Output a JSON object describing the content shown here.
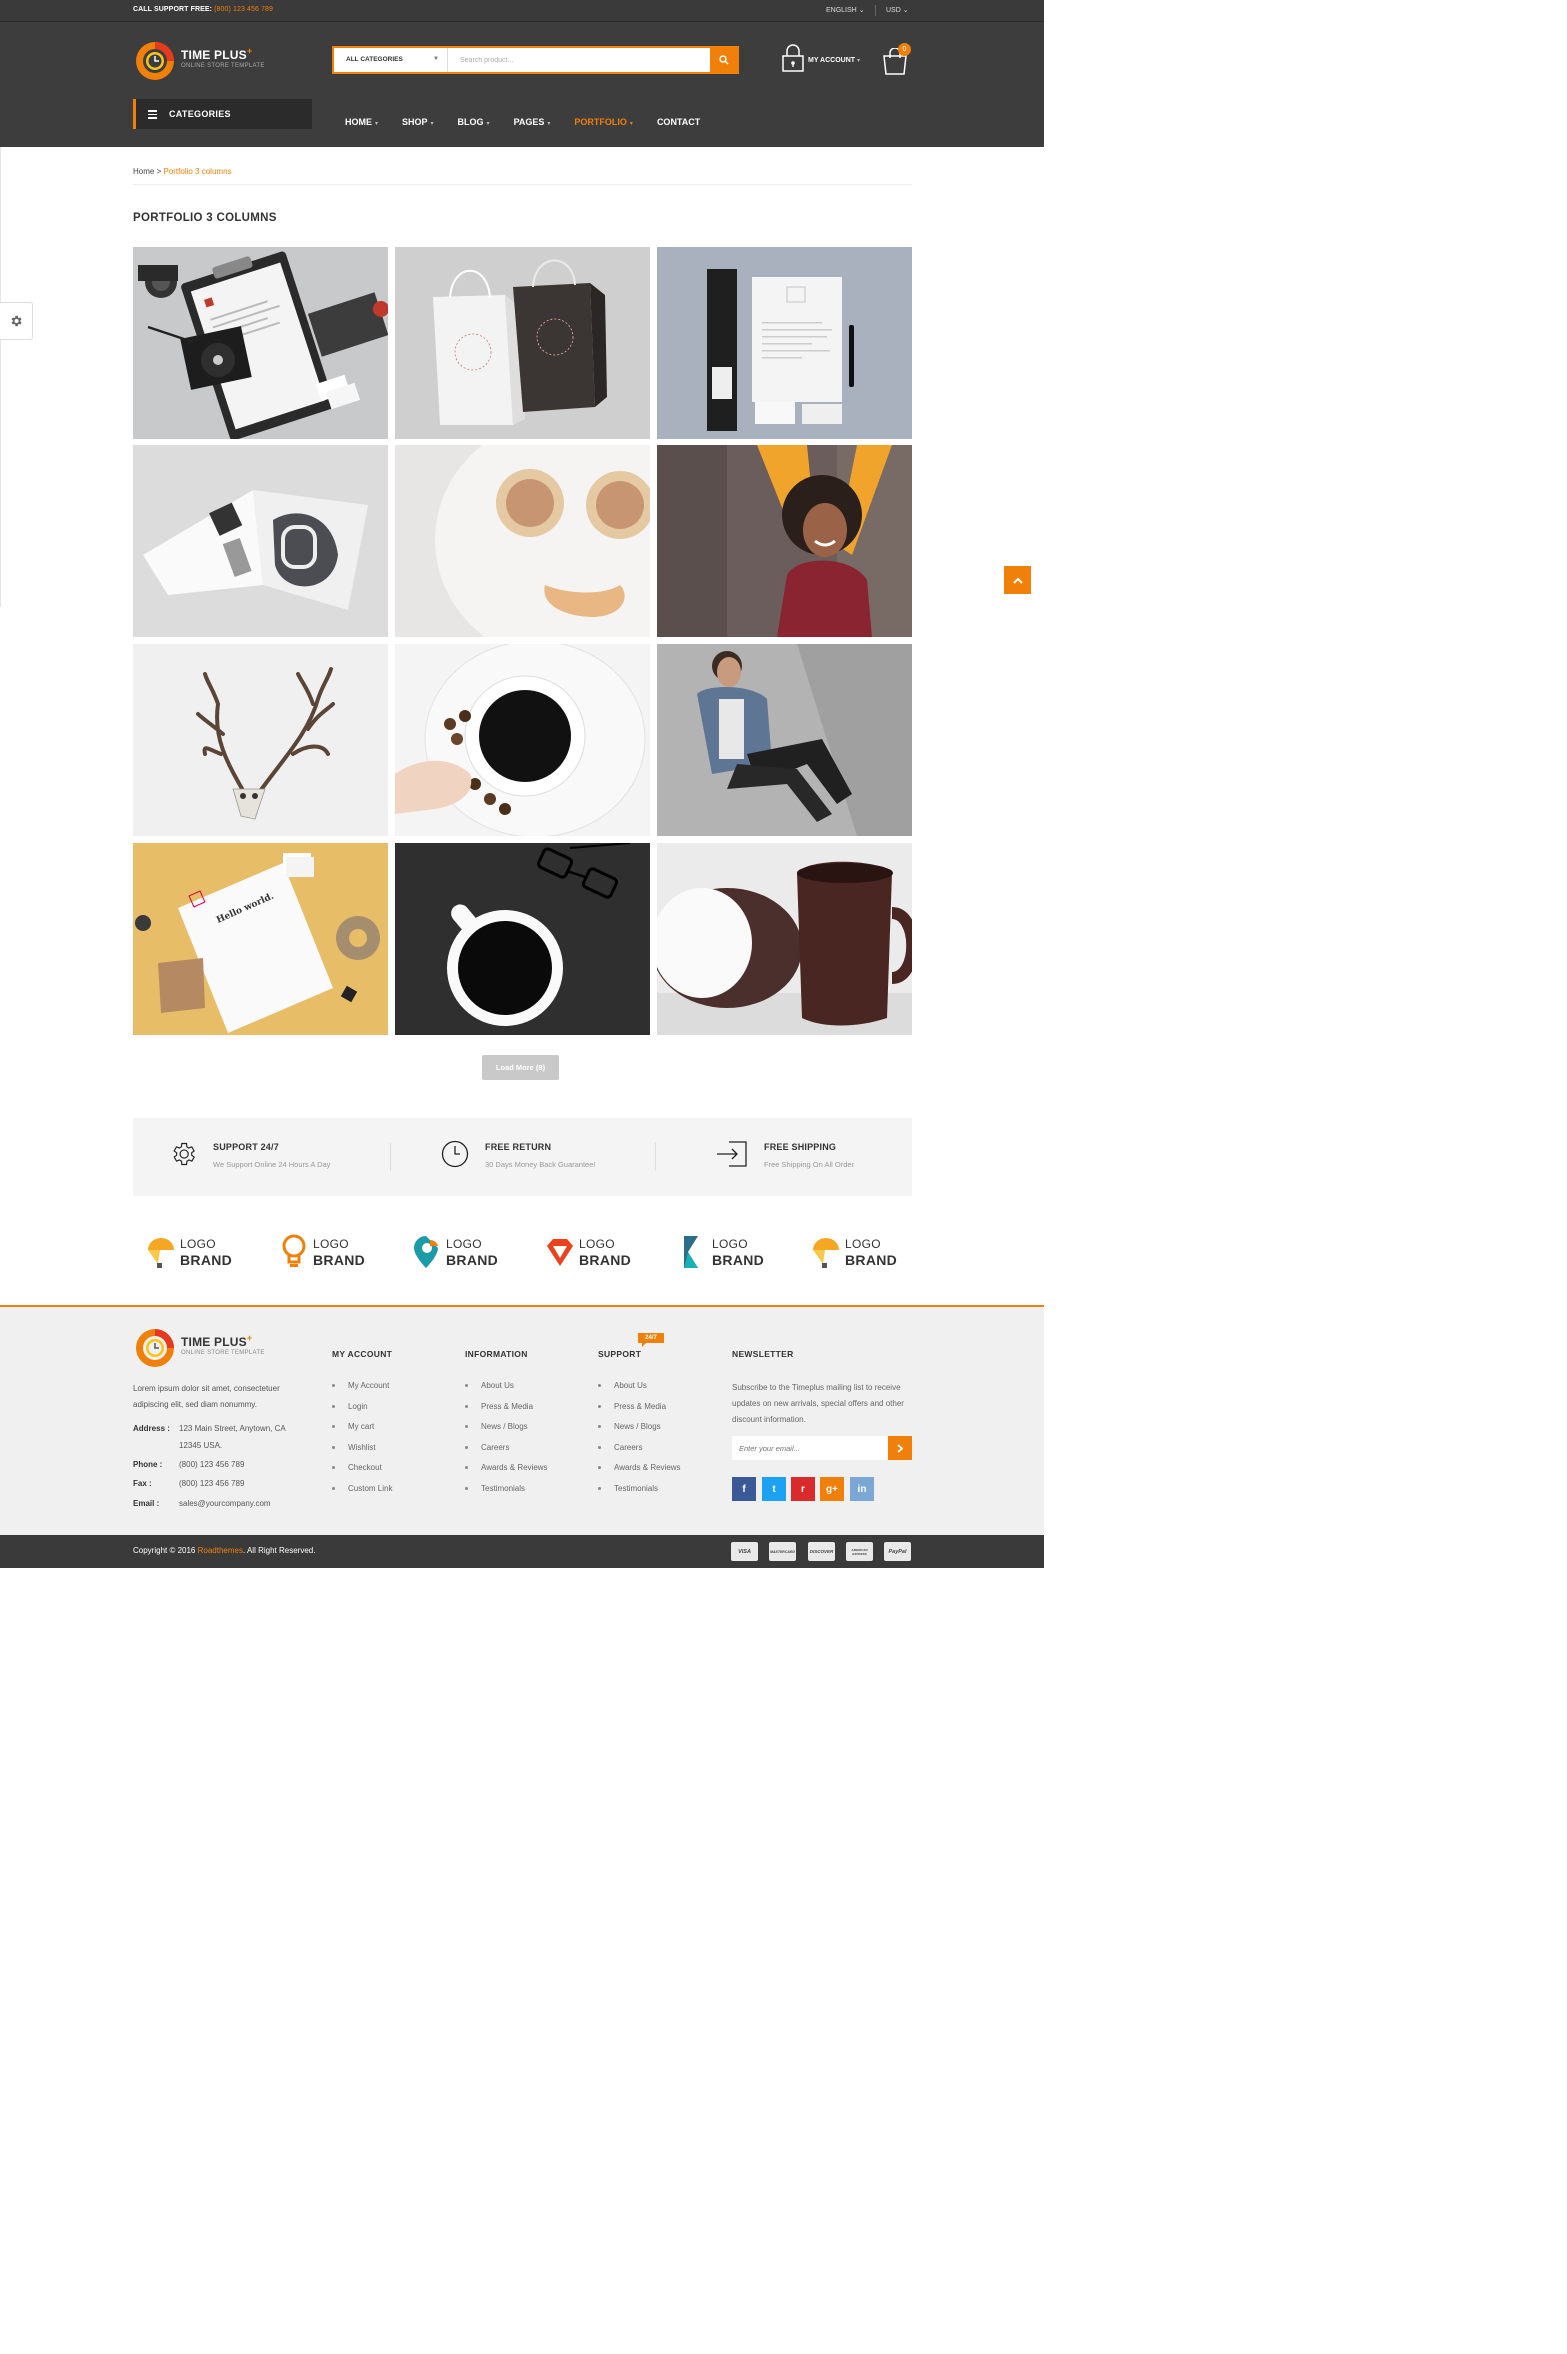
{
  "topbar": {
    "support_label": "CALL SUPPORT FREE:",
    "support_phone": "(800) 123 456  789",
    "language": "ENGLISH",
    "currency": "USD"
  },
  "header": {
    "logo_title": "TIME PLUS",
    "logo_subtitle": "ONLINE STORE TEMPLATE",
    "search_category": "ALL CATEGORIES",
    "search_placeholder": "Search product...",
    "account_label": "MY ACCOUNT",
    "cart_count": "0",
    "categories_label": "CATEGORIES",
    "nav": [
      "HOME",
      "SHOP",
      "BLOG",
      "PAGES",
      "PORTFOLIO",
      "CONTACT"
    ],
    "active_nav": "PORTFOLIO"
  },
  "breadcrumb": {
    "home": "Home",
    "separator": ">",
    "current": "Portfolio 3 columns"
  },
  "page_title": "PORTFOLIO 3 COLUMNS",
  "portfolio_items": [
    "stationery-clipboard-mockup",
    "shopping-bag-mockup",
    "letterhead-mockup",
    "magazine-mockup",
    "pancake-smiley",
    "curly-hair-woman",
    "deer-skull-antlers",
    "coffee-cup-beans",
    "man-sitting",
    "hello-world-letter",
    "black-coffee-glasses",
    "brown-mugs"
  ],
  "load_more_label": "Load More (8)",
  "services": [
    {
      "title": "SUPPORT 24/7",
      "desc": "We Support Online 24 Hours A Day",
      "icon": "gear-icon"
    },
    {
      "title": "FREE RETURN",
      "desc": "30 Days Money Back Guarantee!",
      "icon": "clock-icon"
    },
    {
      "title": "FREE SHIPPING",
      "desc": "Free Shipping On All Order",
      "icon": "signin-icon"
    }
  ],
  "brands": [
    {
      "line1": "LOGO",
      "line2": "BRAND"
    },
    {
      "line1": "LOGO",
      "line2": "BRAND"
    },
    {
      "line1": "LOGO",
      "line2": "BRAND"
    },
    {
      "line1": "LOGO",
      "line2": "BRAND"
    },
    {
      "line1": "LOGO",
      "line2": "BRAND"
    },
    {
      "line1": "LOGO",
      "line2": "BRAND"
    }
  ],
  "footer": {
    "about": "Lorem ipsum dolor sit amet, consectetuer adipiscing elit, sed diam nonummy.",
    "address_label": "Address :",
    "address_line1": "123 Main Street, Anytown, CA",
    "address_line2": "12345 USA.",
    "phone_label": "Phone :",
    "phone": "(800) 123 456 789",
    "fax_label": "Fax :",
    "fax": "(800) 123 456 789",
    "email_label": "Email :",
    "email": "sales@yourcompany.com",
    "columns": [
      {
        "heading": "MY ACCOUNT",
        "links": [
          "My Account",
          "Login",
          "My cart",
          "Wishlist",
          "Checkout",
          "Custom Link"
        ]
      },
      {
        "heading": "INFORMATION",
        "links": [
          "About Us",
          "Press & Media",
          "News / Blogs",
          "Careers",
          "Awards & Reviews",
          "Testimonials"
        ]
      },
      {
        "heading": "SUPPORT",
        "links": [
          "About Us",
          "Press & Media",
          "News / Blogs",
          "Careers",
          "Awards & Reviews",
          "Testimonials"
        ]
      }
    ],
    "support_badge": "24/7",
    "newsletter_heading": "NEWSLETTER",
    "newsletter_text": "Subscribe to the Timeplus mailing list to receive updates on new arrivals, special offers and other discount information.",
    "newsletter_placeholder": "Enter your email...",
    "social": [
      {
        "name": "facebook-icon",
        "glyph": "f",
        "color": "#3b5998"
      },
      {
        "name": "twitter-icon",
        "glyph": "t",
        "color": "#1da1f2"
      },
      {
        "name": "rss-icon",
        "glyph": "r",
        "color": "#d92b2b"
      },
      {
        "name": "googleplus-icon",
        "glyph": "g+",
        "color": "#f0800a"
      },
      {
        "name": "linkedin-icon",
        "glyph": "in",
        "color": "#7aa7d4"
      }
    ],
    "copyright_pre": "Copyright © 2016",
    "copyright_brand": "Roadthemes",
    "copyright_post": ". All Right Reserved.",
    "payments": [
      "VISA",
      "MASTERCARD",
      "DISCOVER",
      "AMERICAN EXPRESS",
      "PayPal"
    ]
  },
  "colors": {
    "accent": "#f0800a",
    "header_bg": "#3d3d3d",
    "footer_bg": "#f0f0f0"
  }
}
